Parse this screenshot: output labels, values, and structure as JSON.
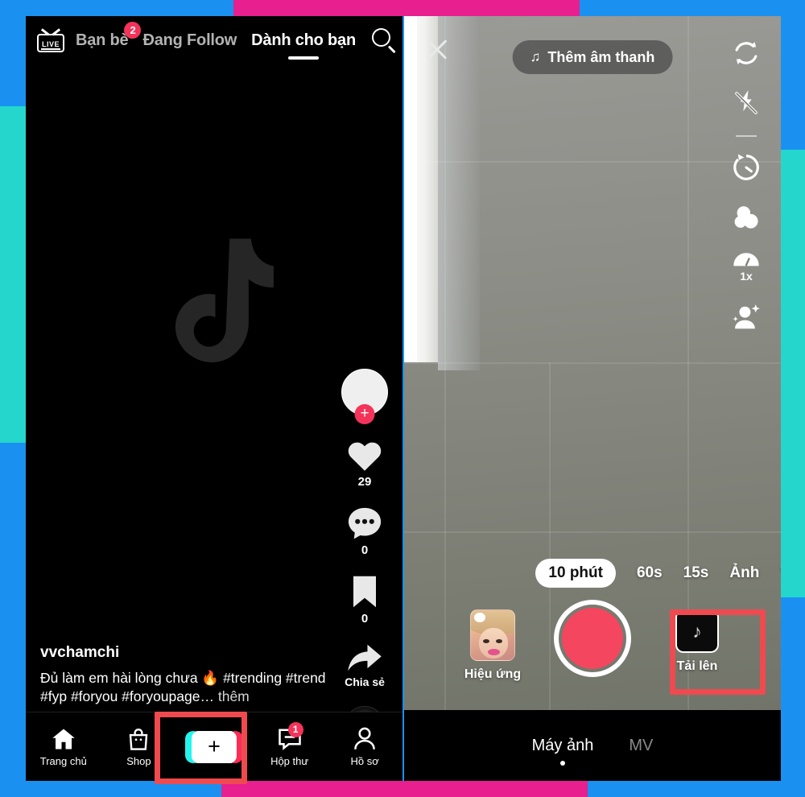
{
  "frame": {
    "blue": "#1a91f0",
    "pink": "#e81f8f",
    "cyan": "#25d6cd",
    "highlight": "#ef4a4f"
  },
  "feed": {
    "topbar": {
      "live_label": "LIVE",
      "live_icon": "live-tv-icon",
      "tabs": [
        {
          "label": "Bạn bè",
          "active": false,
          "badge": "2"
        },
        {
          "label": "Đang Follow",
          "active": false,
          "badge": ""
        },
        {
          "label": "Dành cho bạn",
          "active": true,
          "badge": ""
        }
      ],
      "search_icon": "search-icon"
    },
    "watermark": "tiktok-note-logo",
    "actions": {
      "avatar": {
        "icon": "avatar",
        "follow_plus": "+"
      },
      "like": {
        "icon": "heart-icon",
        "count": "29"
      },
      "comment": {
        "icon": "comment-icon",
        "count": "0"
      },
      "bookmark": {
        "icon": "bookmark-icon",
        "count": "0"
      },
      "share": {
        "icon": "share-arrow-icon",
        "label": "Chia sẻ"
      },
      "music": {
        "icon": "music-disc-icon"
      }
    },
    "caption": {
      "username": "vvchamchi",
      "text": "Đủ làm em hài lòng chưa 🔥 #trending #trend #fyp #foryou #foryoupage…",
      "more": " thêm"
    },
    "nav": [
      {
        "label": "Trang chủ",
        "icon": "home-icon",
        "badge": "",
        "active": true
      },
      {
        "label": "Shop",
        "icon": "shop-bag-icon",
        "badge": "",
        "active": false
      },
      {
        "label": "",
        "icon": "create-plus-icon",
        "badge": "",
        "active": false
      },
      {
        "label": "Hộp thư",
        "icon": "inbox-icon",
        "badge": "1",
        "active": false
      },
      {
        "label": "Hồ sơ",
        "icon": "profile-person-icon",
        "badge": "",
        "active": false
      }
    ]
  },
  "camera": {
    "close_icon": "close-x-icon",
    "add_sound": {
      "label": "Thêm âm thanh",
      "icon": "music-note-icon"
    },
    "tools": [
      {
        "name": "flip-camera-icon",
        "label": ""
      },
      {
        "name": "flash-off-icon",
        "label": ""
      },
      {
        "name": "timer-icon",
        "label": ""
      },
      {
        "name": "filters-icon",
        "label": ""
      },
      {
        "name": "speed-icon",
        "label": "1x"
      },
      {
        "name": "beautify-icon",
        "label": ""
      }
    ],
    "durations": [
      {
        "label": "10 phút",
        "active": true
      },
      {
        "label": "60s",
        "active": false
      },
      {
        "label": "15s",
        "active": false
      },
      {
        "label": "Ảnh",
        "active": false
      },
      {
        "label": "V",
        "active": false
      }
    ],
    "effects": {
      "label": "Hiệu ứng",
      "icon": "effects-thumbnail"
    },
    "record": {
      "icon": "record-button"
    },
    "upload": {
      "label": "Tải lên",
      "icon": "upload-thumbnail"
    },
    "modes": [
      {
        "label": "Máy ảnh",
        "active": true
      },
      {
        "label": "MV",
        "active": false
      }
    ]
  }
}
